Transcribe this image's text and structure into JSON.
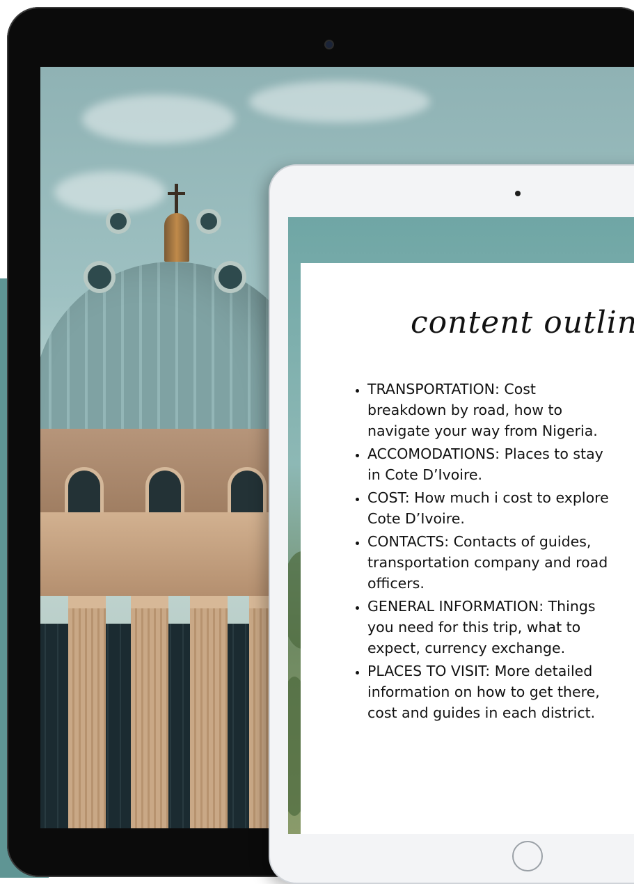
{
  "colors": {
    "teal_panel": "#5f9594",
    "back_tablet": "#0b0b0b",
    "front_tablet": "#f3f4f6",
    "card": "#ffffff",
    "text": "#111111"
  },
  "back_tablet": {
    "screen_image": "basilica-dome-photo"
  },
  "front_tablet": {
    "screen_image": "landscape-photo",
    "card": {
      "title": "content outline.",
      "items": [
        "TRANSPORTATION: Cost breakdown by road, how to navigate your way from Nigeria.",
        "ACCOMODATIONS: Places to stay in Cote D’Ivoire.",
        "COST: How much i cost to explore Cote D’Ivoire.",
        "CONTACTS:  Contacts of guides, transportation company and road officers.",
        "GENERAL INFORMATION: Things you need for this trip, what to expect, currency exchange.",
        "PLACES TO VISIT:  More detailed information on how to get there, cost and guides in each district."
      ],
      "item_lines": [
        [
          "TRANSPORTATION: Cost",
          "breakdown by road, how to",
          "navigate your way from Nigeria."
        ],
        [
          "ACCOMODATIONS: Places to stay",
          "in Cote D’Ivoire."
        ],
        [
          "COST: How much i cost to explore",
          "Cote D’Ivoire."
        ],
        [
          "CONTACTS:  Contacts of guides,",
          "transportation company and road",
          "officers."
        ],
        [
          "GENERAL INFORMATION: Things",
          "you need for this trip, what to",
          "expect, currency exchange."
        ],
        [
          "PLACES TO VISIT:  More detailed",
          "information on how to get there,",
          "cost and guides in each district."
        ]
      ]
    }
  }
}
